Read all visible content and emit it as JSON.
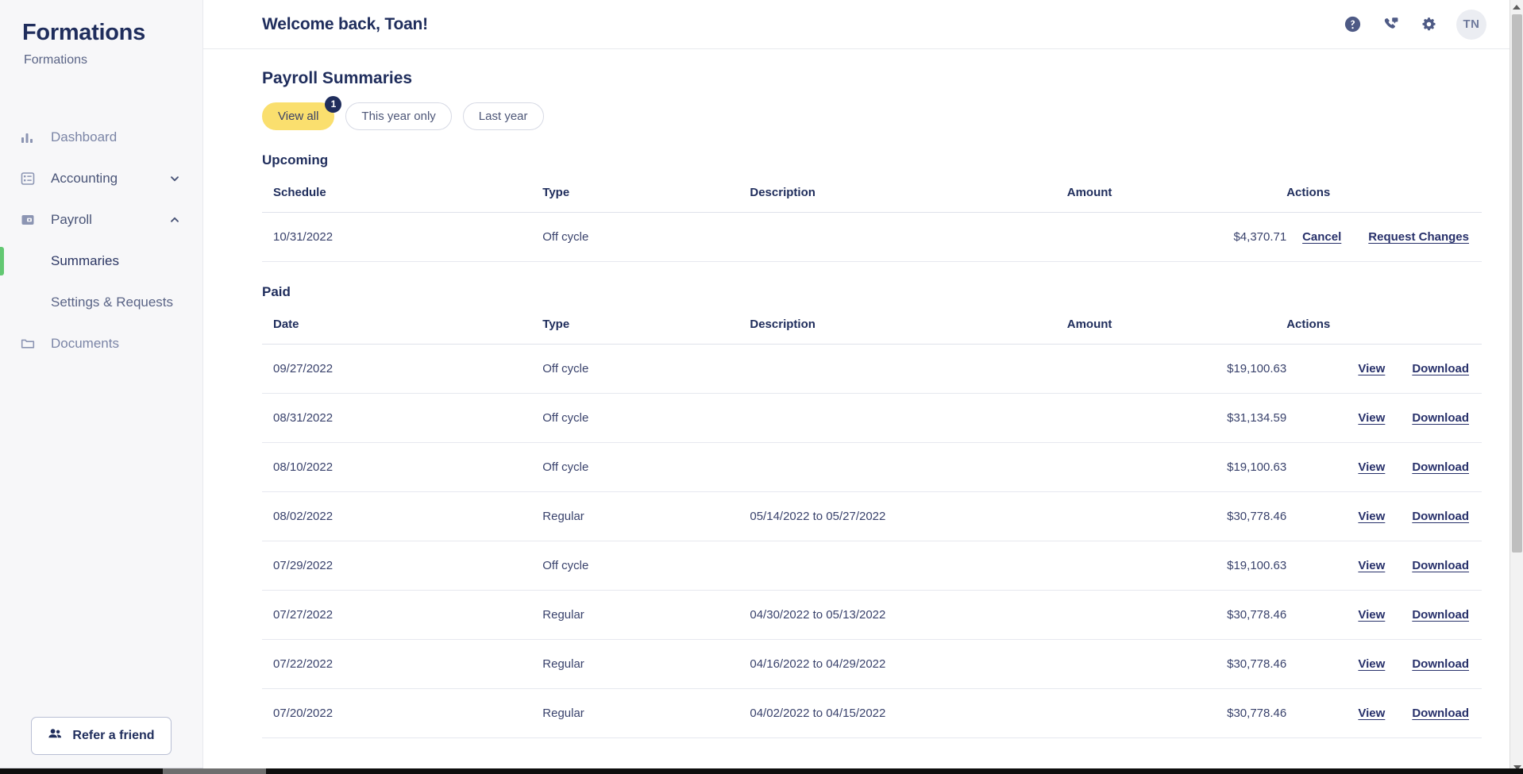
{
  "sidebar": {
    "brand": "Formations",
    "org": "Formations",
    "items": [
      {
        "label": "Dashboard",
        "icon": "bar-chart-icon"
      },
      {
        "label": "Accounting",
        "icon": "list-icon",
        "chevron": "chevron-down-icon"
      },
      {
        "label": "Payroll",
        "icon": "wallet-icon",
        "chevron": "chevron-up-icon"
      }
    ],
    "payroll_children": [
      {
        "label": "Summaries",
        "active": true
      },
      {
        "label": "Settings & Requests",
        "active": false
      }
    ],
    "documents": {
      "label": "Documents",
      "icon": "folder-icon"
    },
    "refer": {
      "label": "Refer a friend",
      "icon": "people-icon"
    },
    "active_accent": "#63c873"
  },
  "topbar": {
    "welcome": "Welcome back, Toan!",
    "icons": [
      {
        "name": "help-icon"
      },
      {
        "name": "phone-icon"
      },
      {
        "name": "gear-icon"
      }
    ],
    "avatar_initials": "TN"
  },
  "page": {
    "title": "Payroll Summaries",
    "filters": [
      {
        "label": "View all",
        "selected": true,
        "badge": "1"
      },
      {
        "label": "This year only",
        "selected": false
      },
      {
        "label": "Last year",
        "selected": false
      }
    ],
    "accent_yellow": "#fadf6e",
    "navy": "#1f2d5c"
  },
  "upcoming": {
    "heading": "Upcoming",
    "columns": [
      "Schedule",
      "Type",
      "Description",
      "Amount",
      "Actions"
    ],
    "rows": [
      {
        "date": "10/31/2022",
        "type": "Off cycle",
        "description": "",
        "amount": "$4,370.71",
        "actions": [
          "Cancel",
          "Request Changes"
        ]
      }
    ]
  },
  "paid": {
    "heading": "Paid",
    "columns": [
      "Date",
      "Type",
      "Description",
      "Amount",
      "Actions"
    ],
    "actions": [
      "View",
      "Download"
    ],
    "rows": [
      {
        "date": "09/27/2022",
        "type": "Off cycle",
        "description": "",
        "amount": "$19,100.63"
      },
      {
        "date": "08/31/2022",
        "type": "Off cycle",
        "description": "",
        "amount": "$31,134.59"
      },
      {
        "date": "08/10/2022",
        "type": "Off cycle",
        "description": "",
        "amount": "$19,100.63"
      },
      {
        "date": "08/02/2022",
        "type": "Regular",
        "description": "05/14/2022 to 05/27/2022",
        "amount": "$30,778.46"
      },
      {
        "date": "07/29/2022",
        "type": "Off cycle",
        "description": "",
        "amount": "$19,100.63"
      },
      {
        "date": "07/27/2022",
        "type": "Regular",
        "description": "04/30/2022 to 05/13/2022",
        "amount": "$30,778.46"
      },
      {
        "date": "07/22/2022",
        "type": "Regular",
        "description": "04/16/2022 to 04/29/2022",
        "amount": "$30,778.46"
      },
      {
        "date": "07/20/2022",
        "type": "Regular",
        "description": "04/02/2022 to 04/15/2022",
        "amount": "$30,778.46"
      }
    ]
  }
}
